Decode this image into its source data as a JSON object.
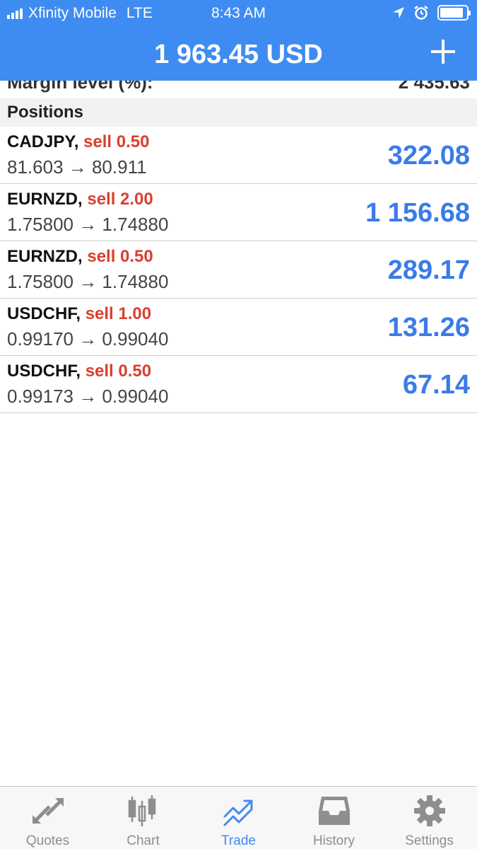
{
  "status": {
    "carrier": "Xfinity Mobile",
    "network": "LTE",
    "time": "8:43 AM"
  },
  "header": {
    "title": "1 963.45 USD"
  },
  "summary": {
    "margin_label": "Margin level (%):",
    "margin_value": "2 435.63"
  },
  "positions_header": "Positions",
  "positions": [
    {
      "symbol": "CADJPY,",
      "side": "sell 0.50",
      "prices": "81.603 → 80.911",
      "profit": "322.08"
    },
    {
      "symbol": "EURNZD,",
      "side": "sell 2.00",
      "prices": "1.75800 → 1.74880",
      "profit": "1 156.68"
    },
    {
      "symbol": "EURNZD,",
      "side": "sell 0.50",
      "prices": "1.75800 → 1.74880",
      "profit": "289.17"
    },
    {
      "symbol": "USDCHF,",
      "side": "sell 1.00",
      "prices": "0.99170 → 0.99040",
      "profit": "131.26"
    },
    {
      "symbol": "USDCHF,",
      "side": "sell 0.50",
      "prices": "0.99173 → 0.99040",
      "profit": "67.14"
    }
  ],
  "tabs": [
    {
      "label": "Quotes",
      "icon": "quotes-icon"
    },
    {
      "label": "Chart",
      "icon": "chart-icon"
    },
    {
      "label": "Trade",
      "icon": "trade-icon",
      "active": true
    },
    {
      "label": "History",
      "icon": "history-icon"
    },
    {
      "label": "Settings",
      "icon": "settings-icon"
    }
  ],
  "colors": {
    "accent": "#3e8cf1",
    "sell": "#d9402f",
    "profit": "#3a7be8",
    "tab_inactive": "#8e8e8e"
  }
}
